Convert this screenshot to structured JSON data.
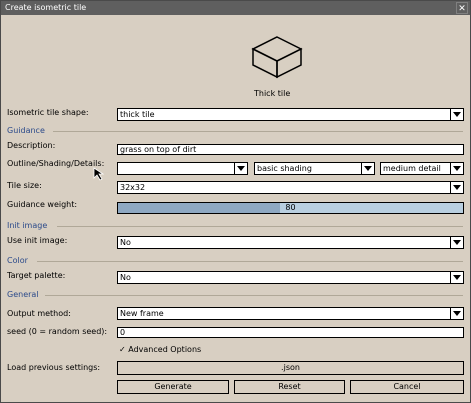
{
  "window": {
    "title": "Create isometric tile"
  },
  "preview": {
    "caption": "Thick tile",
    "icon": "cube-icon"
  },
  "shape": {
    "label": "Isometric tile shape:",
    "value": "thick tile"
  },
  "guidance": {
    "heading": "Guidance",
    "description_label": "Description:",
    "description_value": "grass on top of dirt",
    "osd_label": "Outline/Shading/Details:",
    "outline_value": "",
    "shading_value": "basic shading",
    "detail_value": "medium detail",
    "tile_size_label": "Tile size:",
    "tile_size_value": "32x32",
    "weight_label": "Guidance weight:",
    "weight_value": "80",
    "weight_fraction": 0.47
  },
  "init_image": {
    "heading": "Init image",
    "label": "Use init image:",
    "value": "No"
  },
  "color": {
    "heading": "Color",
    "label": "Target palette:",
    "value": "No"
  },
  "general": {
    "heading": "General",
    "output_label": "Output method:",
    "output_value": "New frame",
    "seed_label": "seed (0 = random seed):",
    "seed_value": "0",
    "advanced_label": "Advanced Options",
    "advanced_checked": true,
    "load_label": "Load previous settings:",
    "load_button": ".json"
  },
  "buttons": {
    "generate": "Generate",
    "reset": "Reset",
    "cancel": "Cancel"
  },
  "colors": {
    "background": "#d8cfc2",
    "titlebar": "#5f5f5f",
    "section": "#2b4a8a",
    "slider": "#b9cfe0"
  }
}
